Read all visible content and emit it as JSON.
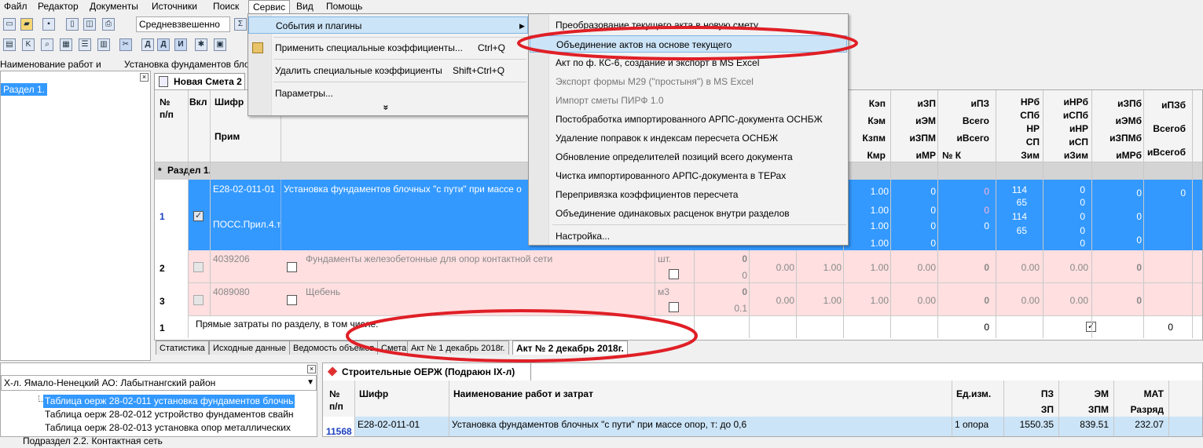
{
  "menubar": {
    "items": [
      "Файл",
      "Редактор",
      "Документы",
      "Источники",
      "Поиск",
      "Сервис",
      "Вид",
      "Помощь"
    ]
  },
  "toolbar": {
    "combo_calc": "Средневзвешенно",
    "combo_name": "Наименование работ и",
    "combo_name2": "Установка фундаментов блочн"
  },
  "service_menu": {
    "items": [
      {
        "label": "События и плагины",
        "shortcut": ""
      },
      {
        "label": "Применить специальные коэффициенты...",
        "shortcut": "Ctrl+Q"
      },
      {
        "label": "Удалить специальные коэффициенты",
        "shortcut": "Shift+Ctrl+Q"
      },
      {
        "label": "Параметры...",
        "shortcut": ""
      }
    ],
    "more": "»"
  },
  "submenu": {
    "items": [
      "Преобразование текущего акта в новую смету",
      "Объединение актов на основе текущего",
      "Акт по ф. КС-6, создание и экспорт в MS Excel",
      "Экспорт формы М29 (\"простыня\") в MS Excel",
      "Импорт сметы ПИРФ 1.0",
      "Постобработка импортированного АРПС-документа ОСНБЖ",
      "Удаление поправок к индексам пересчета ОСНБЖ",
      "Обновление определителей позиций всего документа",
      "Чистка импортированного АРПС-документа в ТЕРах",
      "Перепривязка коэффициентов пересчета",
      "Объединение одинаковых расценок внутри разделов",
      "Настройка..."
    ]
  },
  "tree": {
    "item": "Раздел 1."
  },
  "doc_tab": "Новая Смета 2",
  "grid": {
    "headers": {
      "no": "№",
      "pp": "п/п",
      "vkl": "Вкл",
      "shifr": "Шифр",
      "prim": "Прим",
      "c1": [
        "Кэп",
        "Кэм",
        "Кзпм",
        "Кмр"
      ],
      "c2": [
        "иЗП",
        "иЭМ",
        "иЗПМ",
        "иМР"
      ],
      "c3": [
        "иПЗ",
        "Всего",
        "иВсего",
        "№ К"
      ],
      "c4": [
        "НРб",
        "СПб",
        "НР",
        "СП",
        "Зим"
      ],
      "c5": [
        "иНРб",
        "иСПб",
        "иНР",
        "иСП",
        "иЗим"
      ],
      "c6": [
        "иЗПб",
        "иЭМб",
        "иЗПМб",
        "иМРб"
      ],
      "c7": [
        "иПЗб",
        "Всегоб",
        "иВсегоб"
      ]
    },
    "section": "Раздел 1.",
    "row1": {
      "num": "1",
      "code": "Е28-02-011-01",
      "name": "Установка фундаментов блочных \"с пути\" при массе о",
      "prim": "ПОСС.Прил.4.т",
      "k": [
        "1.00",
        "1.00",
        "1.00",
        "1.00"
      ],
      "iz": [
        "0",
        "0",
        "0",
        "0"
      ],
      "ipz": [
        "0",
        "0",
        "0"
      ],
      "nrb": [
        "114",
        "65",
        "114",
        "65"
      ],
      "inrb": [
        "0",
        "0",
        "0",
        "0",
        "0"
      ],
      "izpb": [
        "0",
        "0",
        "0"
      ],
      "ipzb": [
        "0"
      ]
    },
    "row2": {
      "num": "2",
      "code": "4039206",
      "name": "Фундаменты железобетонные для опор контактной сети",
      "unit": "шт.",
      "q": "0",
      "q2": "0",
      "v": [
        "0.00",
        "1.00",
        "1.00",
        "0.00"
      ],
      "ipz": "0",
      "nrb": "0.00",
      "inrb": "0.00",
      "izpb": "0"
    },
    "row3": {
      "num": "3",
      "code": "4089080",
      "name": "Щебень",
      "unit": "м3",
      "q": "0",
      "q2": "0.1",
      "v": [
        "0.00",
        "1.00",
        "1.00",
        "0.00"
      ],
      "ipz": "0",
      "nrb": "0.00",
      "inrb": "0.00",
      "izpb": "0"
    },
    "total": {
      "num": "1",
      "label": "Прямые затраты по разделу, в том числе:",
      "v1": "0",
      "v2": "0"
    }
  },
  "bottom_tabs": [
    "Статистика",
    "Исходные данные",
    "Ведомость объемов",
    "Смета",
    "Акт № 1 декабрь 2018г.",
    "Акт № 2 декабрь 2018г."
  ],
  "region": "Х-л. Ямало-Ненецкий АО: Лабытнангский район",
  "tables": [
    "Таблица оерж 28-02-011 установка фундаментов блочнь",
    "Таблица оерж 28-02-012 устройство фундаментов свайн",
    "Таблица оерж 28-02-013 установка опор металлических",
    "Подраздел 2.2. Контактная сеть"
  ],
  "lower_panel": {
    "title": "Строительные ОЕРЖ (Подраюн IX-л)",
    "headers": {
      "no": "№",
      "pp": "п/п",
      "shifr": "Шифр",
      "name": "Наименование работ и затрат",
      "unit": "Ед.изм.",
      "pz": "ПЗ",
      "zp": "ЗП",
      "em": "ЭМ",
      "zpm": "ЗПМ",
      "mat": "МАТ",
      "razr": "Разряд"
    },
    "row": {
      "num": "11568",
      "code": "Е28-02-011-01",
      "name": "Установка фундаментов блочных \"с пути\" при массе опор, т: до 0,6",
      "unit": "1 опора",
      "pz": "1550.35",
      "em": "839.51",
      "mat": "232.07"
    }
  },
  "colors": {
    "selected": "#3399ff",
    "pink": "#ffdfe0",
    "highlight": "#cce4f7",
    "annotation": "#e01f26"
  }
}
